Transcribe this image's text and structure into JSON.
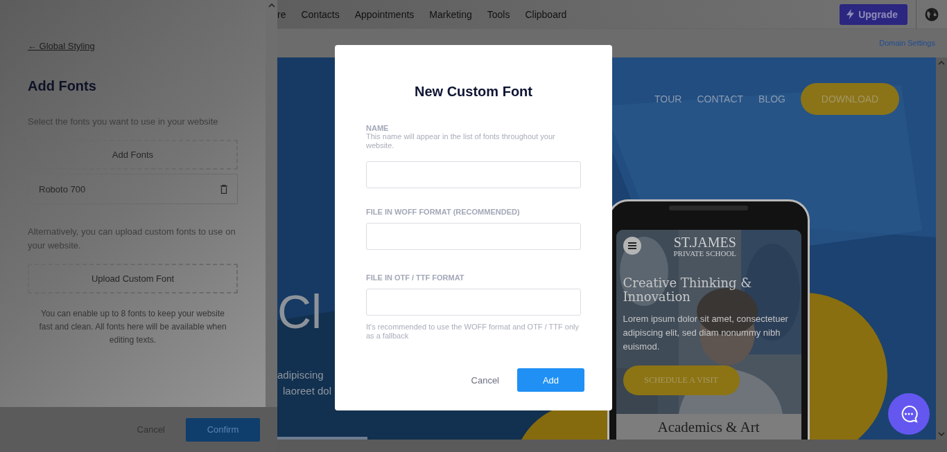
{
  "top_nav": {
    "items": [
      "re",
      "Contacts",
      "Appointments",
      "Marketing",
      "Tools",
      "Clipboard"
    ],
    "upgrade_button": "Upgrade"
  },
  "sub_bar": {
    "link": "Domain Settings"
  },
  "side_panel": {
    "back_link": "← Global Styling",
    "title": "Add Fonts",
    "intro": "Select the fonts you want to use in your website",
    "add_fonts_button": "Add Fonts",
    "fonts": [
      {
        "name": "Roboto 700"
      }
    ],
    "custom_intro": "Alternatively, you can upload custom fonts to use on your website.",
    "upload_button": "Upload Custom Font",
    "note": "You can enable up to 8 fonts to keep your website fast and clean. All fonts here will be available when editing texts.",
    "cancel": "Cancel",
    "confirm": "Confirm"
  },
  "preview": {
    "nav": [
      {
        "label": "TOUR",
        "kind": "link"
      },
      {
        "label": "CONTACT",
        "kind": "link"
      },
      {
        "label": "BLOG",
        "kind": "link"
      },
      {
        "label": "DOWNLOAD",
        "kind": "button"
      }
    ],
    "hero_heading": "Cl",
    "hero_lines": [
      "adipiscing",
      "laoreet dol"
    ],
    "phone": {
      "logo_title": "ST.JAMES",
      "logo_subtitle": "PRIVATE SCHOOL",
      "heading": "Creative Thinking & Innovation",
      "text": "Lorem ipsum dolor sit amet, consectetuer adipiscing elit, sed diam nonummy nibh euismod.",
      "button": "SCHEDULE A VISIT",
      "section_title": "Academics & Art"
    }
  },
  "dialog": {
    "title": "New Custom Font",
    "fields": [
      {
        "label": "NAME",
        "hint": "This name will appear in the list of fonts throughout your website."
      },
      {
        "label": "FILE IN WOFF FORMAT (RECOMMENDED)"
      },
      {
        "label": "FILE IN OTF / TTF FORMAT"
      }
    ],
    "note": "It's recommended to use the WOFF format and OTF / TTF only as a fallback",
    "cancel": "Cancel",
    "add": "Add"
  }
}
